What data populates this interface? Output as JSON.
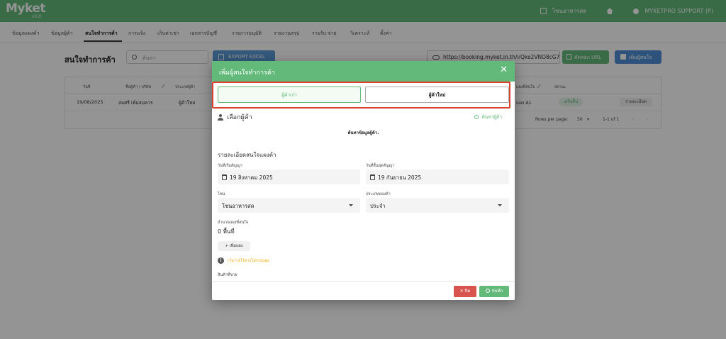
{
  "app": {
    "logo": "Myket",
    "logo_sub": "v3.0",
    "zone_label": "โซนอาหารสด",
    "user_label": "MYKETPRO SUPPORT (P)"
  },
  "nav": {
    "items": [
      "ข้อมูลแผงค้า",
      "ข้อมูลผู้ค้า",
      "สนใจทำการค้า",
      "การแจ้ง",
      "เก็บค่าเช่า",
      "เอกสารบัญชี",
      "รายการอนุมัติ",
      "รายงานสรุป",
      "รายรับ-จ่าย",
      "วิเคราะห์",
      "ตั้งค่า"
    ]
  },
  "page": {
    "title": "สนใจทำการค้า",
    "search_placeholder": "ค้นหา",
    "export_label": "EXPORT EXCEL",
    "url": "https://booking.myket.in.th/i/Qke2VNO8cG7c",
    "copy_label": "คัดลอก URL",
    "add_label": "เพิ่มผู้สนใจ"
  },
  "table": {
    "headers": [
      "วันที่",
      "ชื่อผู้ค้า / บริษัท",
      "ประเภทผู้ค้า",
      "แผงที่สนใจ",
      "สถานะ"
    ],
    "row": {
      "date": "19/08/2025",
      "name": "สมศรี เพิ่มสมควร",
      "type": "ผู้ค้าใหม่",
      "stall": "แผง A1",
      "status": "เสร็จสิ้น",
      "action": "รายละเอียด"
    },
    "rows_per_page_label": "Rows per page:",
    "rows_per_page": "50",
    "range": "1-1 of 1"
  },
  "modal": {
    "title": "เพิ่มผู้สนใจทำการค้า",
    "tab_old": "ผู้ค้าเก่า",
    "tab_new": "ผู้ค้าใหม่",
    "select_vendor": "เลือกผู้ค้า",
    "find_vendor": "ค้นหาผู้ค้า",
    "search_hint": "ค้นหาข้อมูลผู้ค้า.",
    "section_title": "รายละเอียดสนใจแผงค้า",
    "start_label": "วันที่เริ่มสัญญา",
    "start_value": "19 สิงหาคม 2025",
    "end_label": "วันที่สิ้นสุดสัญญา",
    "end_value": "19 กันยายน 2025",
    "zone_label": "โซน",
    "zone_value": "โซนอาหารสด",
    "stall_type_label": "ประเภทแผงค้า",
    "stall_type_value": "ประจำ",
    "count_label": "จำนวนแผงที่สนใจ",
    "count_value": "0 พื้นที่",
    "add_stall": "เพิ่มแผง",
    "info_text": "เว้นว่างไว้หากไม่ระบุแผง",
    "products_label": "สินค้าที่ขาย",
    "close_label": "ปิด",
    "save_label": "บันทึก"
  },
  "colors": {
    "brand_green": "#62b979",
    "accent_blue": "#4f8ed6",
    "danger_red": "#d9534f",
    "highlight_frame": "#d9422f",
    "info_orange": "#f0a500"
  }
}
